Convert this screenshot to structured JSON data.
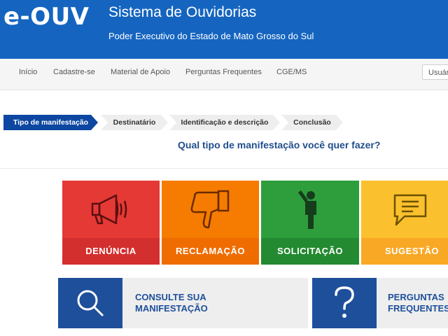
{
  "header": {
    "logo": "e-OUV",
    "title": "Sistema de Ouvidorias",
    "subtitle": "Poder Executivo do Estado de Mato Grosso do Sul",
    "color": "#1565c0"
  },
  "nav": {
    "items": [
      "Início",
      "Cadastre-se",
      "Material de Apoio",
      "Perguntas Frequentes",
      "CGE/MS"
    ],
    "user_button": "Usuári"
  },
  "steps": [
    {
      "label": "Tipo de manifestação",
      "active": true
    },
    {
      "label": "Destinatário",
      "active": false
    },
    {
      "label": "Identificação e descrição",
      "active": false
    },
    {
      "label": "Conclusão",
      "active": false
    }
  ],
  "question": "Qual tipo de manifestação você quer fazer?",
  "tiles": [
    {
      "label": "DENÚNCIA",
      "icon": "megaphone-icon",
      "top_color": "#e53935",
      "band_color": "#d32f2f"
    },
    {
      "label": "RECLAMAÇÃO",
      "icon": "thumbs-down-icon",
      "top_color": "#f57c00",
      "band_color": "#ef6c00"
    },
    {
      "label": "SOLICITAÇÃO",
      "icon": "person-raising-hand-icon",
      "top_color": "#2e9e3c",
      "band_color": "#238a31"
    },
    {
      "label": "SUGESTÃO",
      "icon": "speech-bubble-icon",
      "top_color": "#fbc02d",
      "band_color": "#f9a825"
    }
  ],
  "big_tiles": [
    {
      "line1": "CONSULTE SUA",
      "line2": "MANIFESTAÇÃO",
      "icon": "magnifier-icon"
    },
    {
      "line1": "PERGUNTAS",
      "line2": "FREQUENTES",
      "icon": "question-mark-icon"
    }
  ]
}
